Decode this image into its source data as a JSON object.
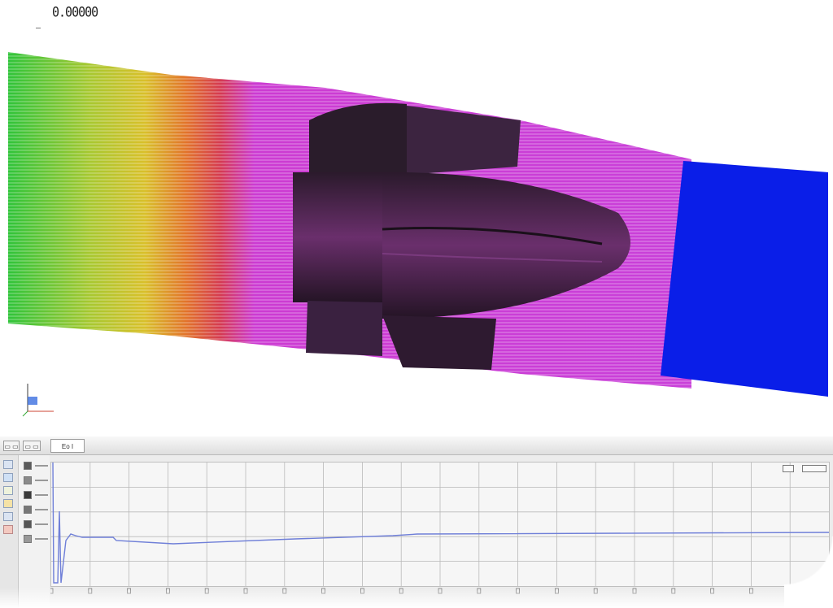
{
  "viewport": {
    "title": "0.00000",
    "scene": "propeller-streamlines",
    "colors": {
      "streamline_high": "#2ecc3a",
      "streamline_mid_yellow": "#d6d22a",
      "streamline_mid_orange": "#e07a1e",
      "streamline_hot": "#d8261e",
      "streamline_low": "#cc35d8",
      "propeller_body": "#3a1f3a",
      "outlet_block": "#0a1ee8"
    },
    "axis_triad_icon": "xyz-axis-triad-icon"
  },
  "graph_panel": {
    "tabs": [
      {
        "label": "▭ ▭",
        "icon": "tab-icon"
      },
      {
        "label": "▭ ▭",
        "icon": "tab-icon"
      },
      {
        "label": "Eo I",
        "icon": "tab-icon"
      }
    ],
    "tool_icons": [
      "chart-icon",
      "arrow-icon",
      "grid-icon",
      "color-icon",
      "cursor-icon",
      "save-icon"
    ],
    "plot_buttons": [
      "zoom-fit-icon",
      "settings-icon"
    ],
    "series_color": "#6f7fd8",
    "grid_color": "#b9b9b9"
  }
}
